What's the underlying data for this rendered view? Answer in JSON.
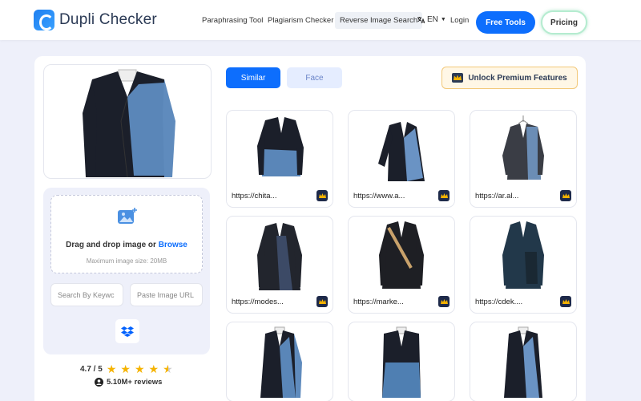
{
  "brand": {
    "name": "Dupli Checker"
  },
  "nav": {
    "links": [
      "Paraphrasing Tool",
      "Plagiarism Checker",
      "Reverse Image Search"
    ],
    "language": "EN",
    "login": "Login",
    "free_tools": "Free Tools",
    "pricing": "Pricing"
  },
  "upload": {
    "drag_text": "Drag and drop image or ",
    "browse": "Browse",
    "max_size": "Maximum image size: 20MB",
    "keyword_placeholder": "Search By Keywc",
    "url_placeholder": "Paste Image URL"
  },
  "rating": {
    "score": "4.7 / 5",
    "reviews": "5.10M+ reviews"
  },
  "tabs": {
    "similar": "Similar",
    "face": "Face"
  },
  "premium": {
    "label": "Unlock Premium Features"
  },
  "results": [
    {
      "url": "https://chita..."
    },
    {
      "url": "https://www.a..."
    },
    {
      "url": "https://ar.al..."
    },
    {
      "url": "https://modes..."
    },
    {
      "url": "https://marke..."
    },
    {
      "url": "https://cdek...."
    },
    {
      "url": ""
    },
    {
      "url": ""
    },
    {
      "url": ""
    }
  ],
  "colors": {
    "primary": "#0d6efd",
    "navy": "#1e2a4a",
    "star": "#f5b301",
    "denim": "#5a86b8",
    "jacket": "#1b1f2a"
  }
}
